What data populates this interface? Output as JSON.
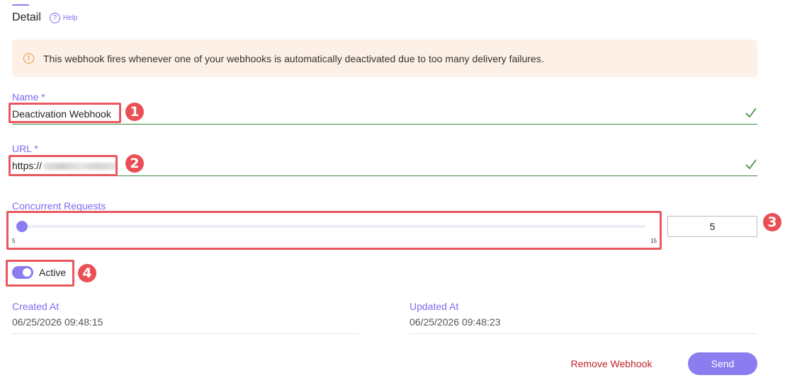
{
  "header": {
    "title": "Detail",
    "help_icon": "question-circle-icon",
    "help_label": "Help"
  },
  "banner": {
    "icon": "warning-circle-icon",
    "text": "This webhook fires whenever one of your webhooks is automatically deactivated due to too many delivery failures."
  },
  "name_field": {
    "label": "Name *",
    "value": "Deactivation Webhook",
    "valid_icon": "check-icon"
  },
  "url_field": {
    "label": "URL *",
    "value_prefix": "https://",
    "valid_icon": "check-icon"
  },
  "concurrent_requests": {
    "label": "Concurrent Requests",
    "min": "5",
    "max": "15",
    "value": "5",
    "slider_value": 5
  },
  "active_toggle": {
    "label": "Active",
    "on": true
  },
  "created": {
    "label": "Created At",
    "value": "06/25/2026 09:48:15"
  },
  "updated": {
    "label": "Updated At",
    "value": "06/25/2026 09:48:23"
  },
  "actions": {
    "remove_label": "Remove Webhook",
    "send_label": "Send"
  },
  "annotations": [
    "1",
    "2",
    "3",
    "4"
  ],
  "colors": {
    "accent": "#8b7cf0",
    "valid": "#3b8a3b",
    "danger": "#c0262d",
    "marker": "#ea4f55",
    "banner_bg": "#fdf0e6"
  }
}
